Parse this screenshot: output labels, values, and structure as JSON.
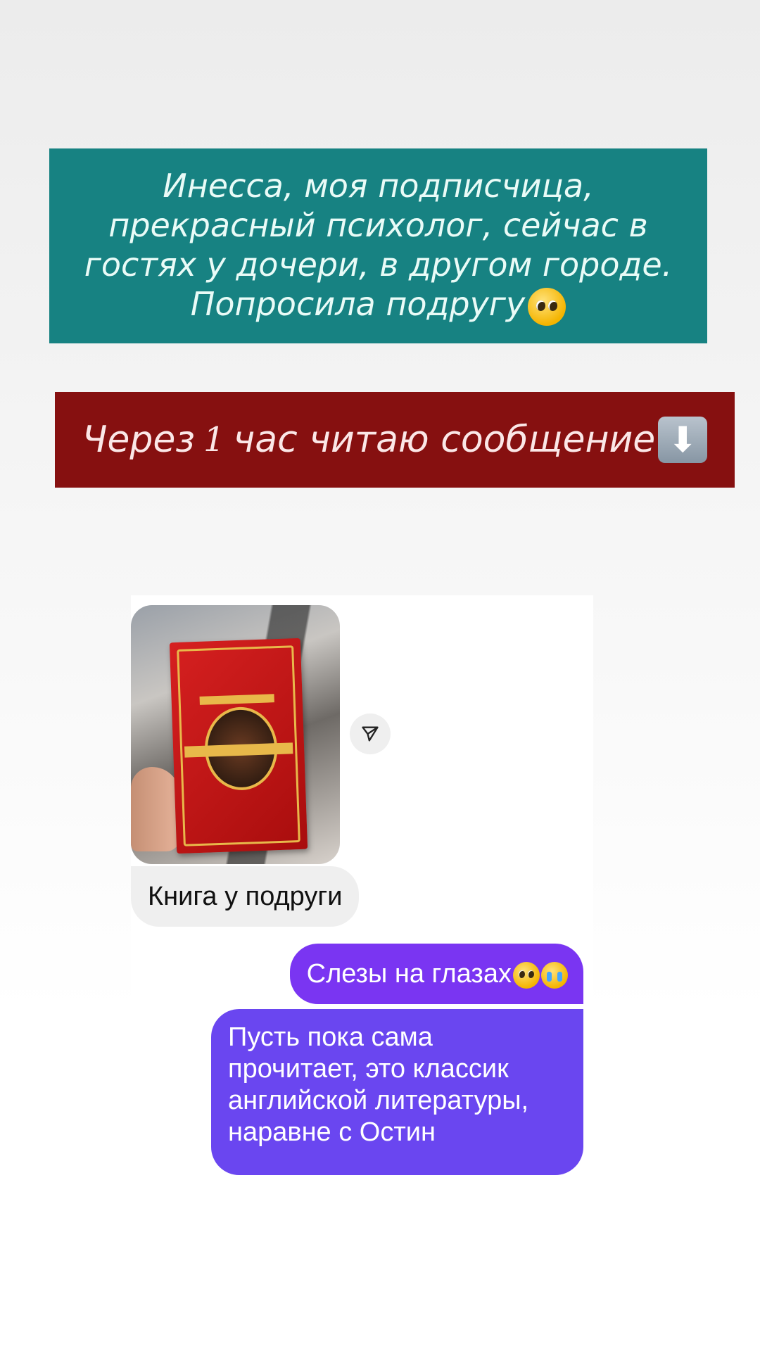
{
  "captions": {
    "teal_text": "Инесса, моя подписчица, прекрасный психолог, сейчас в гостях у дочери, в другом городе. Попросила подругу",
    "teal_emoji": "pleading-face-emoji",
    "red_text_before": "Через",
    "red_number": "1",
    "red_text_after": "час читаю сообщение",
    "red_emoji": "down-arrow-emoji"
  },
  "chat": {
    "incoming_caption": "Книга у подруги",
    "outgoing_1": "Слезы на глазах",
    "outgoing_1_emojis": [
      "pleading-face-emoji",
      "crying-face-emoji"
    ],
    "outgoing_2": "Пусть пока сама прочитает, это классик английской литературы, наравне с Остин"
  },
  "colors": {
    "teal_caption": "#178282",
    "red_caption": "#861010",
    "outgoing_bubble_1": "#7a35f2",
    "outgoing_bubble_2": "#6a46f0",
    "incoming_bubble": "#efefef"
  },
  "icons": {
    "share": "paper-plane-icon"
  }
}
